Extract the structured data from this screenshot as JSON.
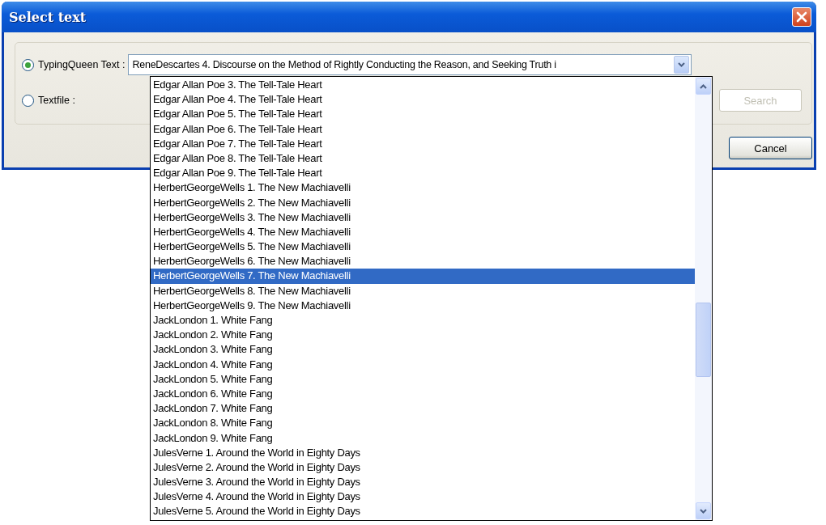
{
  "window": {
    "title": "Select text"
  },
  "options": [
    {
      "label": "TypingQueen Text :",
      "selected": true
    },
    {
      "label": "Textfile :",
      "selected": false
    }
  ],
  "text_combo": {
    "value": "ReneDescartes 4. Discourse on the Method of Rightly Conducting the Reason, and Seeking Truth i",
    "expanded": true
  },
  "search_button": {
    "label": "Search",
    "disabled": true
  },
  "cancel_button": {
    "label": "Cancel"
  },
  "dropdown_items": [
    {
      "text": "Edgar Allan Poe 3. The Tell-Tale Heart",
      "selected": false
    },
    {
      "text": "Edgar Allan Poe 4. The Tell-Tale Heart",
      "selected": false
    },
    {
      "text": "Edgar Allan Poe 5. The Tell-Tale Heart",
      "selected": false
    },
    {
      "text": "Edgar Allan Poe 6. The Tell-Tale Heart",
      "selected": false
    },
    {
      "text": "Edgar Allan Poe 7. The Tell-Tale Heart",
      "selected": false
    },
    {
      "text": "Edgar Allan Poe 8. The Tell-Tale Heart",
      "selected": false
    },
    {
      "text": "Edgar Allan Poe 9. The Tell-Tale Heart",
      "selected": false
    },
    {
      "text": "HerbertGeorgeWells 1. The New Machiavelli",
      "selected": false
    },
    {
      "text": "HerbertGeorgeWells 2. The New Machiavelli",
      "selected": false
    },
    {
      "text": "HerbertGeorgeWells 3. The New Machiavelli",
      "selected": false
    },
    {
      "text": "HerbertGeorgeWells 4. The New Machiavelli",
      "selected": false
    },
    {
      "text": "HerbertGeorgeWells 5. The New Machiavelli",
      "selected": false
    },
    {
      "text": "HerbertGeorgeWells 6. The New Machiavelli",
      "selected": false
    },
    {
      "text": "HerbertGeorgeWells 7. The New Machiavelli",
      "selected": true
    },
    {
      "text": "HerbertGeorgeWells 8. The New Machiavelli",
      "selected": false
    },
    {
      "text": "HerbertGeorgeWells 9. The New Machiavelli",
      "selected": false
    },
    {
      "text": "JackLondon 1. White Fang",
      "selected": false
    },
    {
      "text": "JackLondon 2. White Fang",
      "selected": false
    },
    {
      "text": "JackLondon 3. White Fang",
      "selected": false
    },
    {
      "text": "JackLondon 4. White Fang",
      "selected": false
    },
    {
      "text": "JackLondon 5. White Fang",
      "selected": false
    },
    {
      "text": "JackLondon 6. White Fang",
      "selected": false
    },
    {
      "text": "JackLondon 7. White Fang",
      "selected": false
    },
    {
      "text": "JackLondon 8. White Fang",
      "selected": false
    },
    {
      "text": "JackLondon 9. White Fang",
      "selected": false
    },
    {
      "text": "JulesVerne 1. Around the World in Eighty Days",
      "selected": false
    },
    {
      "text": "JulesVerne 2. Around the World in Eighty Days",
      "selected": false
    },
    {
      "text": "JulesVerne 3. Around the World in Eighty Days",
      "selected": false
    },
    {
      "text": "JulesVerne 4. Around the World in Eighty Days",
      "selected": false
    },
    {
      "text": "JulesVerne 5. Around the World in Eighty Days",
      "selected": false
    }
  ]
}
